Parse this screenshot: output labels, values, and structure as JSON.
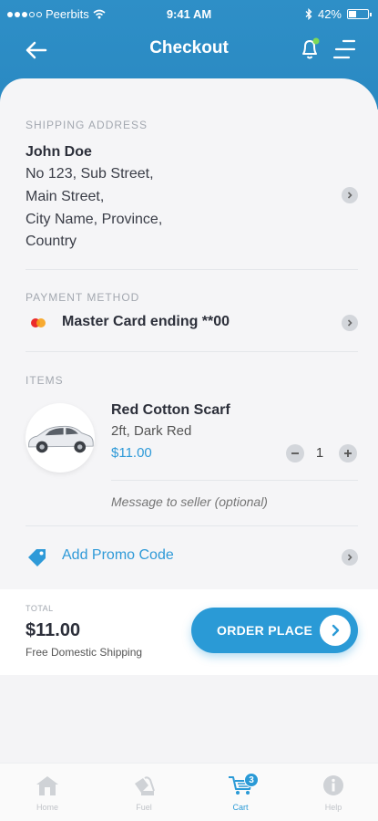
{
  "status_bar": {
    "carrier": "Peerbits",
    "time": "9:41 AM",
    "battery": "42%",
    "battery_level": 0.42
  },
  "header": {
    "title": "Checkout",
    "back_icon": "arrow-left-icon",
    "bell_icon": "bell-icon",
    "menu_icon": "menu-icon"
  },
  "shipping": {
    "label": "SHIPPING ADDRESS",
    "name": "John Doe",
    "lines": [
      "No 123, Sub Street,",
      "Main Street,",
      "City Name, Province,",
      "Country"
    ]
  },
  "payment": {
    "label": "PAYMENT METHOD",
    "card_text": "Master Card ending **00"
  },
  "items": {
    "label": "ITEMS",
    "list": [
      {
        "name": "Red Cotton Scarf",
        "variant": "2ft, Dark Red",
        "price": "$11.00",
        "quantity": "1"
      }
    ],
    "message_placeholder": "Message to seller (optional)"
  },
  "promo": {
    "label": "Add Promo Code"
  },
  "total": {
    "label": "TOTAL",
    "amount": "$11.00",
    "shipping_note": "Free Domestic Shipping",
    "button_label": "ORDER PLACE"
  },
  "bottom_nav": {
    "items": [
      {
        "label": "Home",
        "icon": "home-icon"
      },
      {
        "label": "Fuel",
        "icon": "fuel-icon"
      },
      {
        "label": "Cart",
        "icon": "cart-icon",
        "badge": "3",
        "active": true
      },
      {
        "label": "Help",
        "icon": "info-icon"
      }
    ]
  },
  "colors": {
    "primary": "#2a9ad6",
    "header": "#2e8fc7",
    "notification_dot": "#7ed957"
  }
}
